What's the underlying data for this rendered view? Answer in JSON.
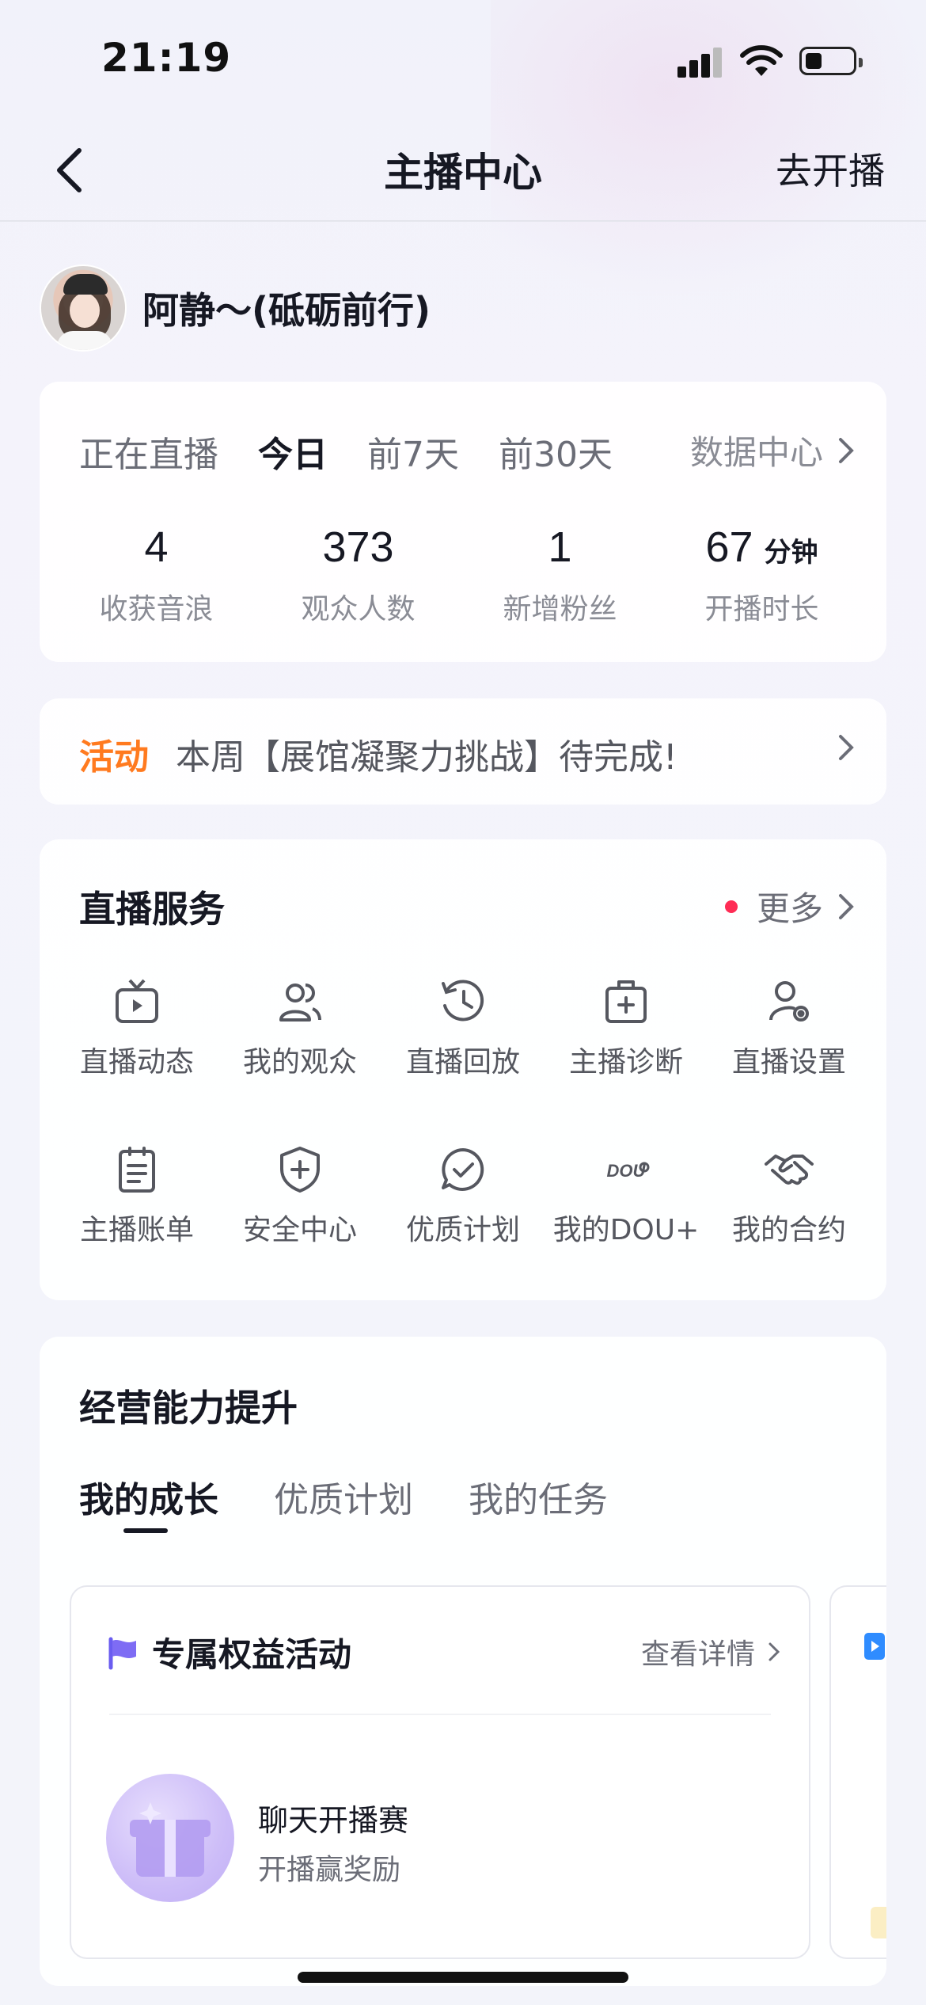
{
  "status_bar": {
    "time": "21:19"
  },
  "nav": {
    "title": "主播中心",
    "action": "去开播"
  },
  "profile": {
    "name": "阿静～(砥砺前行)"
  },
  "stats": {
    "tabs": [
      "正在直播",
      "今日",
      "前7天",
      "前30天"
    ],
    "active_tab": "今日",
    "data_center": "数据中心",
    "items": [
      {
        "value": "4",
        "unit": "",
        "label": "收获音浪"
      },
      {
        "value": "373",
        "unit": "",
        "label": "观众人数"
      },
      {
        "value": "1",
        "unit": "",
        "label": "新增粉丝"
      },
      {
        "value": "67",
        "unit": "分钟",
        "label": "开播时长"
      }
    ]
  },
  "activity": {
    "tag": "活动",
    "text": "本周【展馆凝聚力挑战】待完成!"
  },
  "services": {
    "title": "直播服务",
    "more": "更多",
    "items": [
      {
        "label": "直播动态",
        "icon": "tv-icon"
      },
      {
        "label": "我的观众",
        "icon": "users-icon"
      },
      {
        "label": "直播回放",
        "icon": "replay-icon"
      },
      {
        "label": "主播诊断",
        "icon": "medkit-icon"
      },
      {
        "label": "直播设置",
        "icon": "user-settings-icon"
      },
      {
        "label": "主播账单",
        "icon": "bill-icon"
      },
      {
        "label": "安全中心",
        "icon": "shield-icon"
      },
      {
        "label": "优质计划",
        "icon": "check-chat-icon"
      },
      {
        "label": "我的DOU+",
        "icon": "dou-icon"
      },
      {
        "label": "我的合约",
        "icon": "handshake-icon"
      }
    ]
  },
  "growth": {
    "title": "经营能力提升",
    "tabs": [
      "我的成长",
      "优质计划",
      "我的任务"
    ],
    "active_tab": "我的成长",
    "benefit": {
      "title": "专属权益活动",
      "link": "查看详情",
      "event": "聊天开播赛",
      "subtitle": "开播赢奖励"
    }
  },
  "colors": {
    "accent": "#fe2c55",
    "activity": "#ff7a1f",
    "text": "#161823",
    "muted": "#8a8c95"
  }
}
